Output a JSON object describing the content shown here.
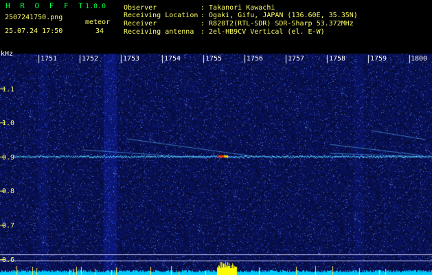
{
  "header": {
    "app_title": "H R O F F T",
    "version": "1.0.0",
    "filename": "2507241750.png",
    "datetime": "25.07.24 17:50",
    "meteor_label": "meteor",
    "meteor_count": "34",
    "info": [
      {
        "key": "Observer",
        "value": ": Takanori Kawachi"
      },
      {
        "key": "Receiving Location",
        "value": ": Ogaki, Gifu, JAPAN (136.60E, 35.35N)"
      },
      {
        "key": "Receiver",
        "value": ": R820T2(RTL-SDR) SDR-Sharp 53.372MHz"
      },
      {
        "key": "Receiving antenna",
        "value": ": 2el-HB9CV Vertical (el. E-W)"
      }
    ]
  },
  "axes": {
    "y_unit": "kHz",
    "y_ticks": [
      "1.1",
      "1.0",
      "0.9",
      "0.8",
      "0.7",
      "0.6"
    ],
    "x_ticks": [
      "1751",
      "1752",
      "1753",
      "1754",
      "1755",
      "1756",
      "1757",
      "1758",
      "1759",
      "1800"
    ]
  },
  "colors": {
    "background": "#000000",
    "noise": "#1a2a9a",
    "trace": "#33ccff",
    "hot": "#ff3300",
    "meter": "#00ccff",
    "meter_peak": "#ffff00"
  }
}
